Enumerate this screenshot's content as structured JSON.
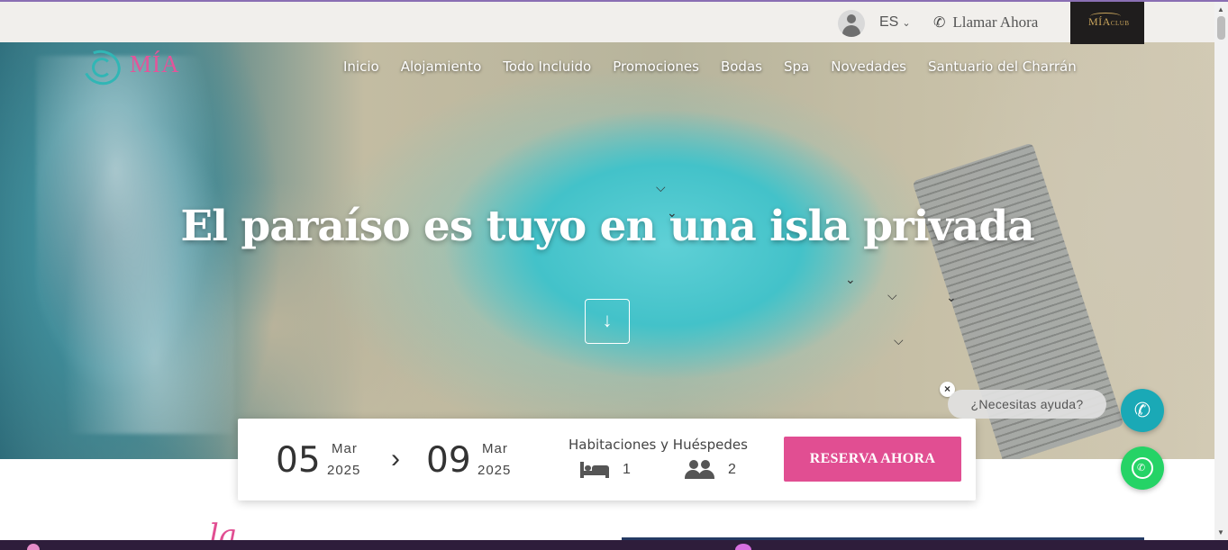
{
  "header": {
    "language": "ES",
    "call_label": "Llamar Ahora",
    "club_logo_text": "MÍA",
    "club_logo_suffix": "CLUB"
  },
  "logo": {
    "name": "MÍA",
    "tagline": ""
  },
  "nav": {
    "items": [
      {
        "label": "Inicio"
      },
      {
        "label": "Alojamiento"
      },
      {
        "label": "Todo Incluido"
      },
      {
        "label": "Promociones"
      },
      {
        "label": "Bodas"
      },
      {
        "label": "Spa"
      },
      {
        "label": "Novedades"
      },
      {
        "label": "Santuario del Charrán"
      }
    ]
  },
  "hero": {
    "headline": "El paraíso es tuyo en una isla privada",
    "scroll_icon": "arrow-down-icon"
  },
  "booking": {
    "checkin": {
      "day": "05",
      "month": "Mar",
      "year": "2025"
    },
    "checkout": {
      "day": "09",
      "month": "Mar",
      "year": "2025"
    },
    "rooms_label": "Habitaciones y Huéspedes",
    "rooms_count": "1",
    "guests_count": "2",
    "reserve_label": "RESERVA AHORA"
  },
  "help": {
    "bubble_text": "¿Necesitas ayuda?"
  },
  "below_fold": {
    "deco_text": "la"
  },
  "colors": {
    "accent_pink": "#e14e92",
    "teal": "#1aa9b6",
    "whatsapp": "#25d366",
    "club_gold": "#c8a45c"
  }
}
